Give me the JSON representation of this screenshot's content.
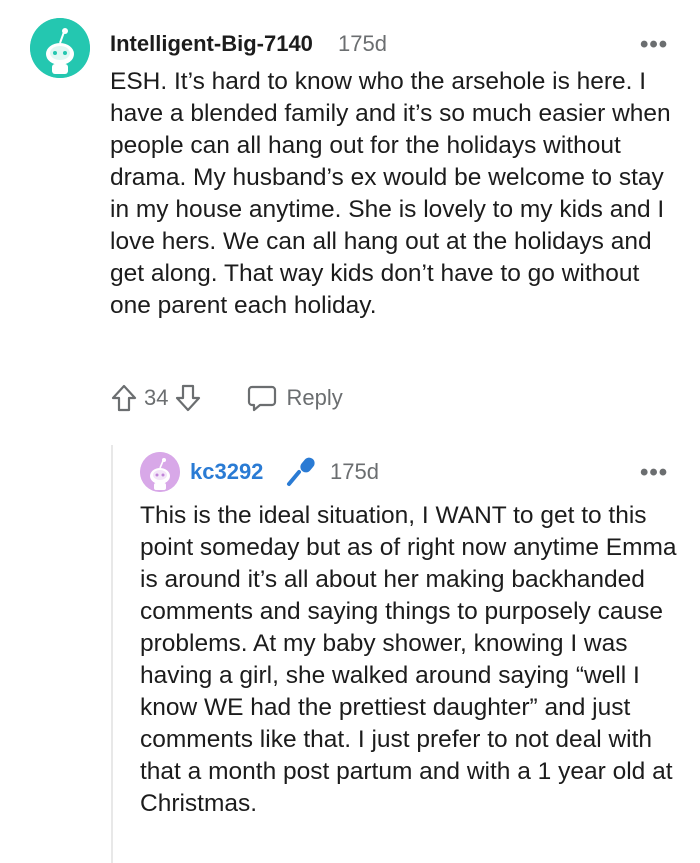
{
  "comment": {
    "username": "Intelligent-Big-7140",
    "age": "175d",
    "more": "•••",
    "avatar_color": "#24c7b0",
    "body": "ESH. It’s hard to know who the arsehole is here. I have a blended family and it’s so much easier when people can all hang out for the holidays without drama. My husband’s ex would be welcome to stay in my house anytime. She is lovely to my kids and I love hers. We can all hang out at the holidays and get along. That way kids don’t have to go without one parent each holiday.",
    "votes": "34",
    "reply_label": "Reply"
  },
  "reply": {
    "username": "kc3292",
    "username_color": "#2a7bd4",
    "badge_icon": "microphone-icon",
    "age": "175d",
    "more": "•••",
    "avatar_color": "#d8a8e8",
    "body": "This is the ideal situation, I WANT to get to this point someday but as of right now anytime Emma is around it’s all about her making backhanded comments and saying things to purposely cause problems. At my baby shower, knowing I was having a girl, she walked around saying “well I know WE had the prettiest daughter” and just comments like that. I just prefer to not deal with that a month post partum and with a 1 year old at Christmas."
  }
}
